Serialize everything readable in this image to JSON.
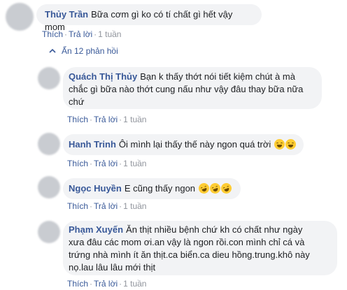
{
  "top_comment": {
    "author": "Thủy Trần",
    "text": "Bữa cơm gì ko có tí chất gì hết vậy mom",
    "like_label": "Thích",
    "reply_label": "Trả lời",
    "time": "1 tuần"
  },
  "hidden_replies_label": "Ẩn 12 phản hồi",
  "replies": [
    {
      "author": "Quách Thị Thủy",
      "lines": [
        "Bạn k thấy thớt nói tiết kiệm chút à mà",
        "chắc gì bữa nào thớt cung nấu như vậy đâu thay bữa nữa",
        "chứ"
      ],
      "like_label": "Thích",
      "reply_label": "Trả lời",
      "time": "1 tuần"
    },
    {
      "author": "Hanh Trinh",
      "text": "Ôi mình lại thấy thế này ngon quá trời",
      "emoji": [
        "grinning-sweat-emoji",
        "grinning-sweat-emoji"
      ],
      "like_label": "Thích",
      "reply_label": "Trả lời",
      "time": "1 tuần"
    },
    {
      "author": "Ngọc Huyền",
      "text": "E cũng thấy ngon",
      "emoji": [
        "rofl-emoji",
        "rofl-emoji",
        "rofl-emoji"
      ],
      "like_label": "Thích",
      "reply_label": "Trả lời",
      "time": "1 tuần"
    },
    {
      "author": "Phạm Xuyến",
      "lines": [
        "Ăn thịt nhiều bệnh chứ kh có chất như ngày",
        "xưa đâu các mom ơi.an vậy là ngon rồi.con mình chỉ cá và",
        "trứng nhà mình ít ăn thịt.ca biển.ca dieu hồng.trung.khô này",
        "nọ.lau lâu lâu mới thịt"
      ],
      "like_label": "Thích",
      "reply_label": "Trả lời",
      "time": "1 tuần"
    }
  ],
  "colors": {
    "link": "#385898",
    "bubble": "#f2f3f5",
    "meta": "#90949c"
  }
}
